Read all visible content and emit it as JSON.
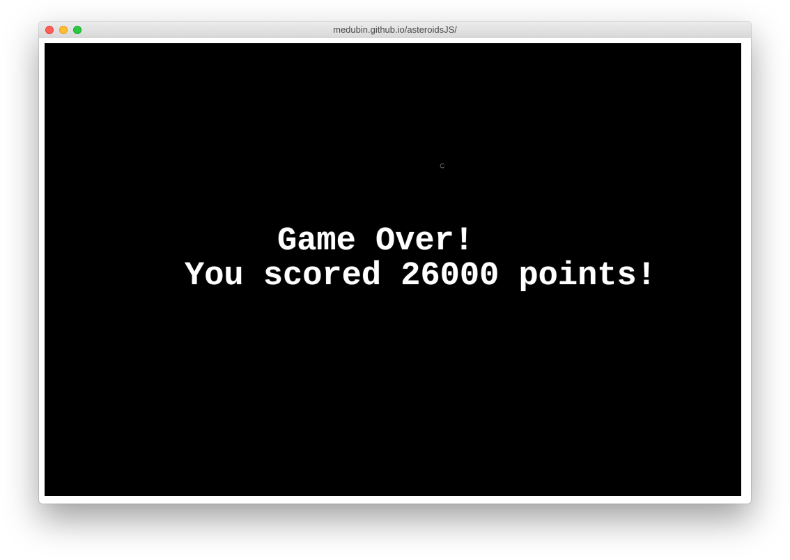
{
  "window": {
    "url": "medubin.github.io/asteroidsJS/"
  },
  "game": {
    "line1": "Game Over!",
    "line2": "You scored 26000 points!",
    "background_color": "#000000",
    "text_color": "#ffffff"
  },
  "icons": {
    "close": "close-button",
    "minimize": "minimize-button",
    "maximize": "maximize-button",
    "ship": "ship-icon"
  }
}
